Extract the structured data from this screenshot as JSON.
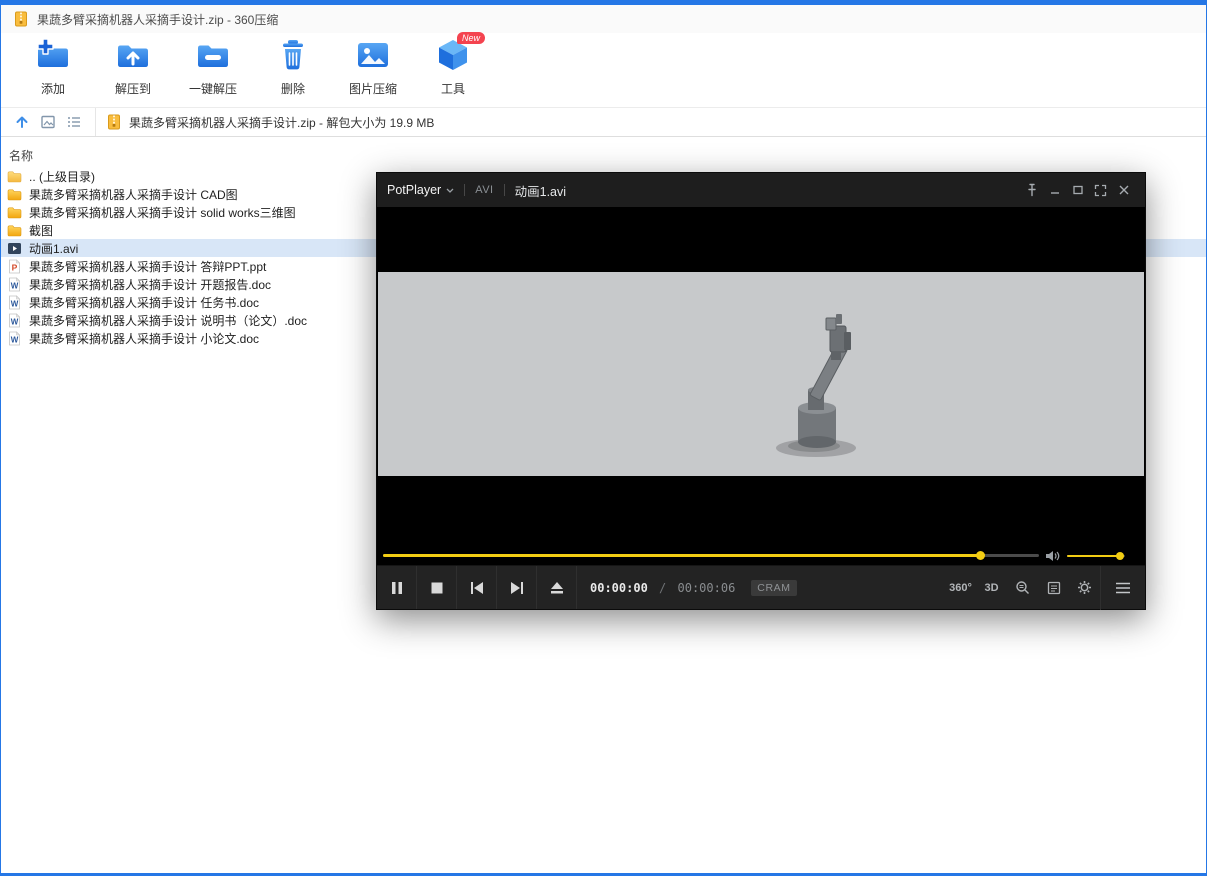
{
  "window": {
    "title": "果蔬多臂采摘机器人采摘手设计.zip - 360压缩"
  },
  "toolbar": {
    "items": [
      {
        "label": "添加"
      },
      {
        "label": "解压到"
      },
      {
        "label": "一键解压"
      },
      {
        "label": "删除"
      },
      {
        "label": "图片压缩"
      },
      {
        "label": "工具",
        "badge": "New"
      }
    ]
  },
  "addressbar": {
    "path": "果蔬多臂采摘机器人采摘手设计.zip - 解包大小为 19.9 MB"
  },
  "filelist": {
    "name_column": "名称",
    "items": [
      {
        "name": ".. (上级目录)",
        "type": "folder-up",
        "selected": false
      },
      {
        "name": "果蔬多臂采摘机器人采摘手设计 CAD图",
        "type": "folder",
        "selected": false
      },
      {
        "name": "果蔬多臂采摘机器人采摘手设计 solid works三维图",
        "type": "folder",
        "selected": false
      },
      {
        "name": "截图",
        "type": "folder",
        "selected": false
      },
      {
        "name": "动画1.avi",
        "type": "avi",
        "selected": true
      },
      {
        "name": "果蔬多臂采摘机器人采摘手设计 答辩PPT.ppt",
        "type": "ppt",
        "selected": false
      },
      {
        "name": "果蔬多臂采摘机器人采摘手设计 开题报告.doc",
        "type": "doc",
        "selected": false
      },
      {
        "name": "果蔬多臂采摘机器人采摘手设计 任务书.doc",
        "type": "doc",
        "selected": false
      },
      {
        "name": "果蔬多臂采摘机器人采摘手设计 说明书（论文）.doc",
        "type": "doc",
        "selected": false
      },
      {
        "name": "果蔬多臂采摘机器人采摘手设计 小论文.doc",
        "type": "doc",
        "selected": false
      }
    ]
  },
  "player": {
    "app_name": "PotPlayer",
    "format_badge": "AVI",
    "media_title": "动画1.avi",
    "time_current": "00:00:00",
    "time_separator": "/",
    "time_total": "00:00:06",
    "codec_badge": "CRAM",
    "progress_pct": 91,
    "volume_pct": 92,
    "btn_360": "360°",
    "btn_3d": "3D"
  },
  "colors": {
    "window_accent": "#2577e6",
    "seek_yellow": "#f2cd13",
    "selected_row": "#d8e6f7",
    "badge_red": "#f4434f"
  }
}
